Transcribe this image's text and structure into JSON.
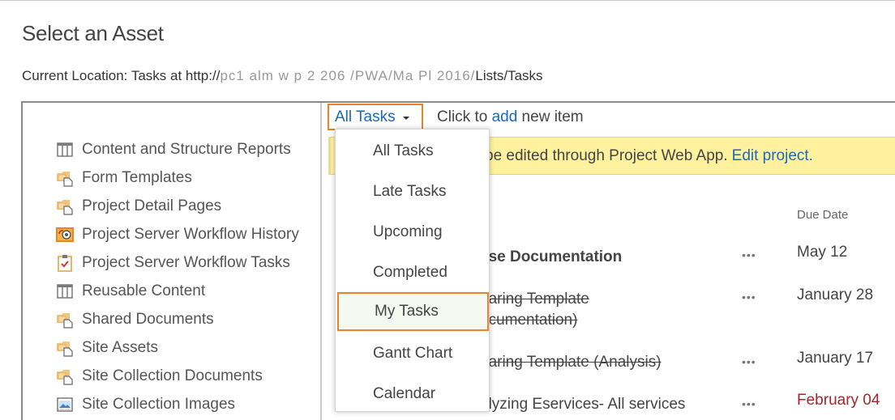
{
  "dialog": {
    "title": "Select an Asset",
    "location_label": "Current Location: Tasks at http://",
    "location_obscured": "pc1  alm  w      p    2 206 /PWA/Ma    Pl   2016/",
    "location_suffix": "Lists/Tasks"
  },
  "assets": [
    {
      "label": "Content and Structure Reports",
      "icon": "list-icon"
    },
    {
      "label": "Form Templates",
      "icon": "folder-document-icon"
    },
    {
      "label": "Project Detail Pages",
      "icon": "folder-document-icon"
    },
    {
      "label": "Project Server Workflow History",
      "icon": "workflow-history-icon"
    },
    {
      "label": "Project Server Workflow Tasks",
      "icon": "clipboard-check-icon"
    },
    {
      "label": "Reusable Content",
      "icon": "list-icon"
    },
    {
      "label": "Shared Documents",
      "icon": "folder-document-icon"
    },
    {
      "label": "Site Assets",
      "icon": "folder-document-icon"
    },
    {
      "label": "Site Collection Documents",
      "icon": "folder-document-icon"
    },
    {
      "label": "Site Collection Images",
      "icon": "image-library-icon"
    }
  ],
  "toolbar": {
    "view_label": "All Tasks",
    "add_prefix": "Click to ",
    "add_link": "add",
    "add_suffix": " new item"
  },
  "banner": {
    "text": "be edited through Project Web App.",
    "link": "Edit project."
  },
  "columns": {
    "due_date": "Due Date"
  },
  "tasks": [
    {
      "title_line1": "ase Documentation",
      "title_line2": "",
      "ellipsis": "•••",
      "due": "May 12",
      "style": "bold",
      "overdue": false
    },
    {
      "title_line1": "paring Template",
      "title_line2": "ocumentation)",
      "ellipsis": "•••",
      "due": "January 28",
      "style": "strike",
      "overdue": false
    },
    {
      "title_line1": "paring Template (Analysis)",
      "title_line2": "",
      "ellipsis": "•••",
      "due": "January 17",
      "style": "strike",
      "overdue": false
    },
    {
      "title_line1": "alyzing Eservices- All services",
      "title_line2": "",
      "ellipsis": "•••",
      "due": "February 04",
      "style": "normal",
      "overdue": true
    }
  ],
  "view_menu": {
    "items": [
      {
        "label": "All Tasks",
        "highlighted": false
      },
      {
        "label": "Late Tasks",
        "highlighted": false
      },
      {
        "label": "Upcoming",
        "highlighted": false
      },
      {
        "label": "Completed",
        "highlighted": false
      },
      {
        "label": "My Tasks",
        "highlighted": true
      },
      {
        "label": "Gantt Chart",
        "highlighted": false
      },
      {
        "label": "Calendar",
        "highlighted": false
      }
    ]
  },
  "colors": {
    "accent_link": "#1a6ab7",
    "highlight_border": "#f0802a",
    "banner_bg": "#fff19d",
    "overdue": "#a4262c"
  }
}
